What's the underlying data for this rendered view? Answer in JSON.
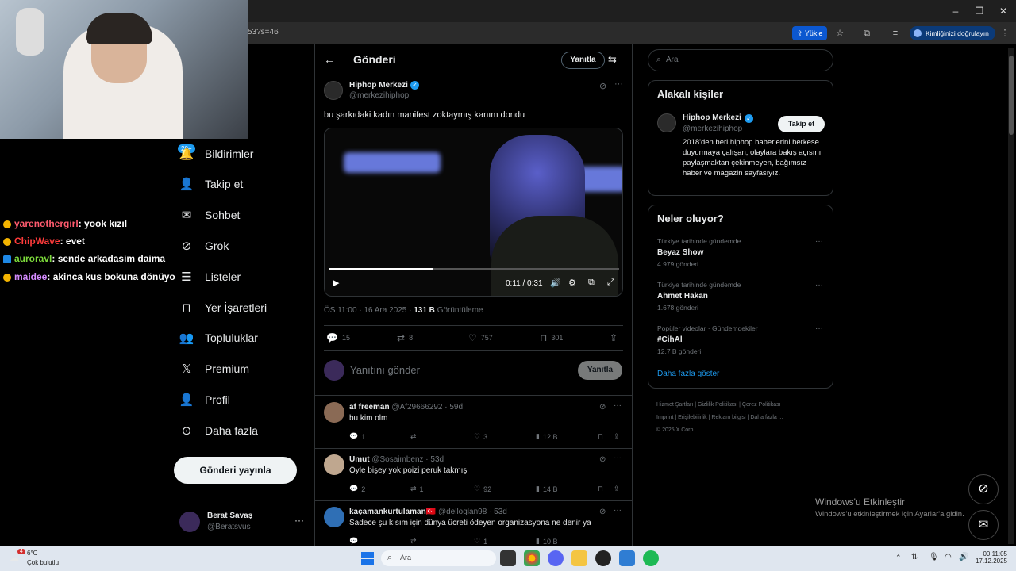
{
  "browser": {
    "url_fragment": "53?s=46",
    "upload_label": "Yükle",
    "verify_label": "Kimliğinizi doğrulayın"
  },
  "chat": [
    {
      "user": "yarenothergirl",
      "msg": ": yook kızıl",
      "color": "#ff5b6e"
    },
    {
      "user": "ChipWave",
      "msg": ": evet",
      "color": "#ff3b3b"
    },
    {
      "user": "auroravl",
      "msg": ": sende arkadasim daima",
      "color": "#7ddc3b"
    },
    {
      "user": "maidee",
      "msg": ": akinca kus bokuna dönüyo",
      "color": "#d58cff"
    }
  ],
  "nav": {
    "badge": "20+",
    "items": [
      "Bildirimler",
      "Takip et",
      "Sohbet",
      "Grok",
      "Listeler",
      "Yer İşaretleri",
      "Topluluklar",
      "Premium",
      "Profil",
      "Daha fazla"
    ],
    "post_button": "Gönderi yayınla",
    "account_name": "Berat Savaş",
    "account_handle": "@Beratsvus"
  },
  "header": {
    "title": "Gönderi",
    "reply_button": "Yanıtla"
  },
  "post": {
    "author": "Hiphop Merkezi",
    "handle": "@merkezihiphop",
    "text": "bu şarkıdaki kadın manifest zoktaymış kanım dondu",
    "video_time": "0:11 / 0:31",
    "video_progress": 0.36,
    "timestamp": "ÖS 11:00 · 16 Ara 2025 · ",
    "views": "131 B",
    "views_label": "Görüntüleme",
    "replies": "15",
    "reposts": "8",
    "likes": "757",
    "bookmarks": "301"
  },
  "reply_box": {
    "placeholder": "Yanıtını gönder",
    "button": "Yanıtla"
  },
  "replies": [
    {
      "name": "af freeman",
      "handle": "@Af29666292 · 59d",
      "text": "bu kim olm",
      "replies": "1",
      "reposts": "",
      "likes": "3",
      "views": "12 B"
    },
    {
      "name": "Umut",
      "handle": "@Sosaimbenz · 53d",
      "text": "Öyle bişey yok poizi peruk takmış",
      "replies": "2",
      "reposts": "1",
      "likes": "92",
      "views": "14 B"
    },
    {
      "name": "kaçamankurtulaman🇹🇷",
      "handle": "@delloglan98 · 53d",
      "text": "Sadece şu kısım için dünya ücreti ödeyen organizasyona ne denir ya",
      "replies": "",
      "reposts": "",
      "likes": "1",
      "views": "10 B"
    }
  ],
  "search": {
    "placeholder": "Ara"
  },
  "related": {
    "title": "Alakalı kişiler",
    "name": "Hiphop Merkezi",
    "handle": "@merkezihiphop",
    "follow": "Takip et",
    "bio": "2018'den beri hiphop haberlerini herkese duyurmaya çalışan, olaylara bakış açısını paylaşmaktan çekinmeyen, bağımsız haber ve magazin sayfasıyız."
  },
  "trends": {
    "title": "Neler oluyor?",
    "items": [
      {
        "label": "Türkiye tarihinde gündemde",
        "name": "Beyaz Show",
        "count": "4.979 gönderi"
      },
      {
        "label": "Türkiye tarihinde gündemde",
        "name": "Ahmet Hakan",
        "count": "1.678 gönderi"
      },
      {
        "label": "Popüler videolar · Gündemdekiler",
        "name": "#CihAl",
        "count": "12,7 B gönderi"
      }
    ],
    "more": "Daha fazla göster"
  },
  "footer": {
    "links1": [
      "Hizmet Şartları",
      "Gizlilik Politikası",
      "Çerez Politikası"
    ],
    "links2": [
      "Imprint",
      "Erişilebilirlik",
      "Reklam bilgisi",
      "Daha fazla ..."
    ],
    "copyright": "© 2025 X Corp."
  },
  "watermark": {
    "title": "Windows'u Etkinleştir",
    "sub": "Windows'u etkinleştirmek için Ayarlar'a gidin."
  },
  "taskbar": {
    "weather_temp": "6°C",
    "weather_desc": "Çok bulutlu",
    "weather_badge": "4",
    "search": "Ara",
    "time": "00:11:05",
    "date": "17.12.2025"
  }
}
